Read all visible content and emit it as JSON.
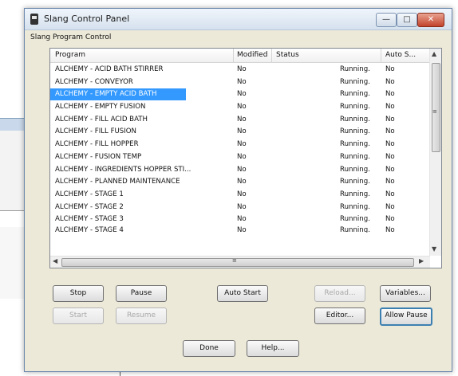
{
  "window": {
    "title": "Slang Control Panel",
    "controls": {
      "minimize": "—",
      "maximize": "□",
      "close": "✕"
    }
  },
  "group_label": "Slang Program Control",
  "table": {
    "columns": [
      "Program",
      "Modified",
      "Status",
      "Auto S..."
    ],
    "rows": [
      {
        "program": "ALCHEMY - ACID BATH STIRRER",
        "modified": "No",
        "status": "Running.",
        "auto": "No"
      },
      {
        "program": "ALCHEMY - CONVEYOR",
        "modified": "No",
        "status": "Running.",
        "auto": "No"
      },
      {
        "program": "ALCHEMY - EMPTY ACID BATH",
        "modified": "No",
        "status": "Running.",
        "auto": "No",
        "selected": true
      },
      {
        "program": "ALCHEMY - EMPTY FUSION",
        "modified": "No",
        "status": "Running.",
        "auto": "No"
      },
      {
        "program": "ALCHEMY - FILL ACID BATH",
        "modified": "No",
        "status": "Running.",
        "auto": "No"
      },
      {
        "program": "ALCHEMY - FILL FUSION",
        "modified": "No",
        "status": "Running.",
        "auto": "No"
      },
      {
        "program": "ALCHEMY - FILL HOPPER",
        "modified": "No",
        "status": "Running.",
        "auto": "No"
      },
      {
        "program": "ALCHEMY - FUSION TEMP",
        "modified": "No",
        "status": "Running.",
        "auto": "No"
      },
      {
        "program": "ALCHEMY - INGREDIENTS HOPPER STI...",
        "modified": "No",
        "status": "Running.",
        "auto": "No"
      },
      {
        "program": "ALCHEMY - PLANNED MAINTENANCE",
        "modified": "No",
        "status": "Running.",
        "auto": "No"
      },
      {
        "program": "ALCHEMY - STAGE 1",
        "modified": "No",
        "status": "Running.",
        "auto": "No"
      },
      {
        "program": "ALCHEMY - STAGE 2",
        "modified": "No",
        "status": "Running.",
        "auto": "No"
      },
      {
        "program": "ALCHEMY - STAGE 3",
        "modified": "No",
        "status": "Running.",
        "auto": "No"
      },
      {
        "program": "ALCHEMY - STAGE 4",
        "modified": "No",
        "status": "Running.",
        "auto": "No"
      }
    ]
  },
  "scroll": {
    "up": "▲",
    "down": "▼",
    "left": "◀",
    "right": "▶",
    "grip": "≡"
  },
  "buttons": {
    "stop": "Stop",
    "pause": "Pause",
    "auto_start": "Auto Start",
    "reload": "Reload...",
    "variables": "Variables...",
    "start": "Start",
    "resume": "Resume",
    "editor": "Editor...",
    "allow_pause": "Allow Pause",
    "done": "Done",
    "help": "Help..."
  },
  "colors": {
    "selection": "#3399ff",
    "close_button": "#c2432c"
  }
}
